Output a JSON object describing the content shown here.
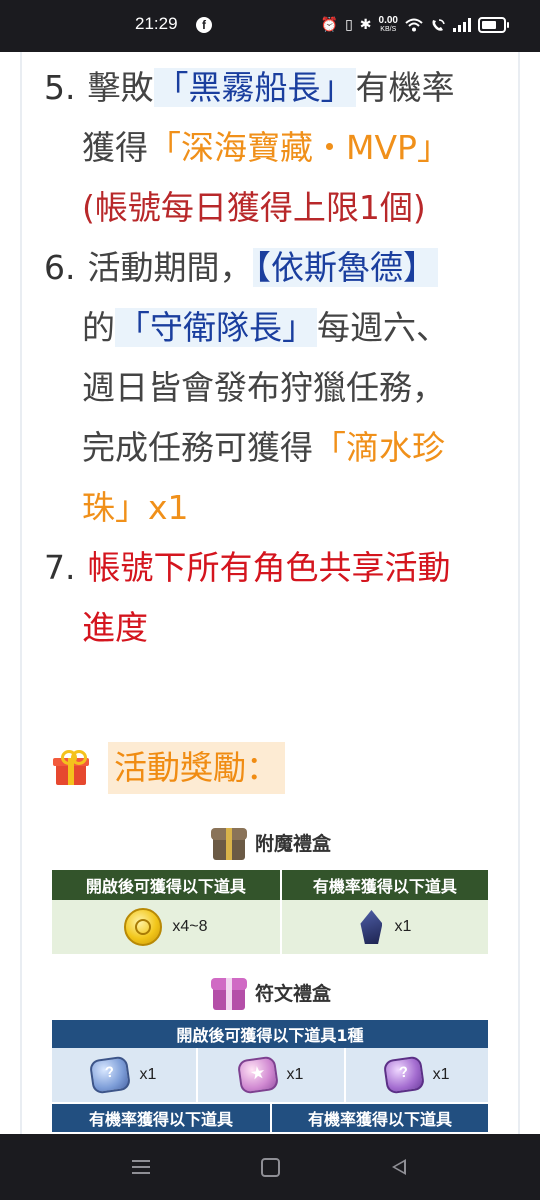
{
  "status_bar": {
    "time": "21:29",
    "app_icon": "facebook-icon",
    "net_speed_value": "0.00",
    "net_speed_unit": "KB/S",
    "icons": [
      "alarm-icon",
      "vibrate-icon",
      "bluetooth-icon",
      "wifi-icon",
      "wifi-calling-icon",
      "signal-icon",
      "battery-icon"
    ]
  },
  "article": {
    "items": [
      {
        "number": "5.",
        "lines": [
          [
            {
              "text": "擊敗",
              "style": "plain"
            },
            {
              "text": "「黑霧船長」",
              "style": "highlight"
            },
            {
              "text": "有機率",
              "style": "plain"
            }
          ],
          [
            {
              "text": "獲得",
              "style": "plain"
            },
            {
              "text": "「深海寶藏・MVP」",
              "style": "orange"
            }
          ],
          [
            {
              "text": "(帳號每日獲得上限1個)",
              "style": "red"
            }
          ]
        ]
      },
      {
        "number": "6.",
        "lines": [
          [
            {
              "text": "活動期間，",
              "style": "plain"
            },
            {
              "text": "【依斯魯德】",
              "style": "highlight"
            }
          ],
          [
            {
              "text": "的",
              "style": "plain"
            },
            {
              "text": "「守衛隊長」",
              "style": "highlight"
            },
            {
              "text": "每週六、",
              "style": "plain"
            }
          ],
          [
            {
              "text": "週日皆會發布狩獵任務，",
              "style": "plain"
            }
          ],
          [
            {
              "text": "完成任務可獲得",
              "style": "plain"
            },
            {
              "text": "「滴水珍",
              "style": "orange"
            }
          ],
          [
            {
              "text": "珠」x1",
              "style": "orange"
            }
          ]
        ]
      },
      {
        "number": "7.",
        "lines": [
          [
            {
              "text": "帳號下所有角色共享活動",
              "style": "bright-red"
            }
          ],
          [
            {
              "text": "進度",
              "style": "bright-red"
            }
          ]
        ]
      }
    ]
  },
  "rewards": {
    "icon": "gift-icon",
    "title": "活動獎勵："
  },
  "enchant_box": {
    "name": "附魔禮盒",
    "icon": "enchant-chest-icon",
    "col1_header": "開啟後可獲得以下道具",
    "col2_header": "有機率獲得以下道具",
    "col1_item": {
      "icon": "gold-coin-icon",
      "qty": "x4~8"
    },
    "col2_item": {
      "icon": "dark-crystal-icon",
      "qty": "x1"
    }
  },
  "rune_box": {
    "name": "符文禮盒",
    "icon": "rune-chest-icon",
    "header": "開啟後可獲得以下道具1種",
    "items": [
      {
        "icon": "blue-rune-stone-icon",
        "qty": "x1"
      },
      {
        "icon": "pink-rune-stone-icon",
        "qty": "x1"
      },
      {
        "icon": "purple-rune-stone-icon",
        "qty": "x1"
      }
    ],
    "bottom_col1_header": "有機率獲得以下道具",
    "bottom_col2_header": "有機率獲得以下道具"
  },
  "nav_bar": {
    "icons": [
      "recent-apps-icon",
      "home-icon",
      "back-icon"
    ]
  },
  "colors": {
    "highlight_bg": "#eaf3fb",
    "highlight_text": "#1a3e9e",
    "orange": "#f0901a",
    "dark_red": "#b8282a",
    "bright_red": "#d4151e",
    "green_header": "#33542b",
    "blue_header": "#224f80"
  }
}
